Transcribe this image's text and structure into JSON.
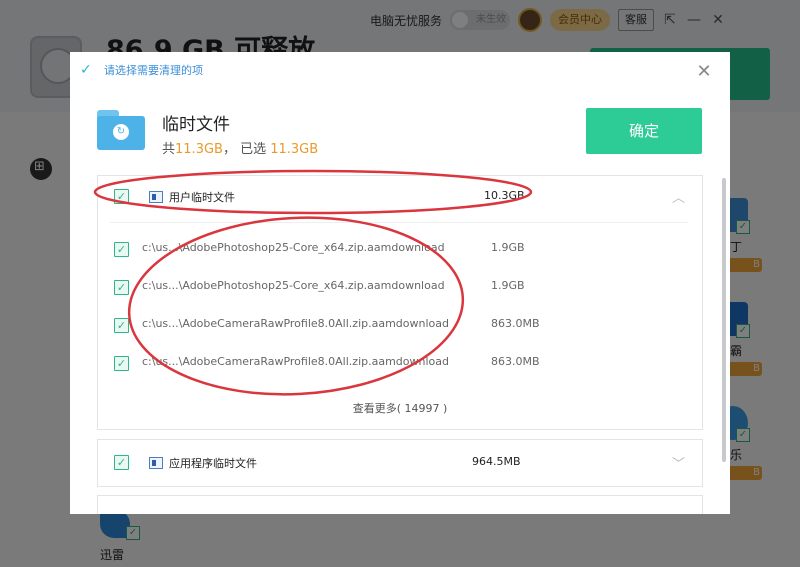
{
  "background_app": {
    "headline": "86.9 GB 可释放",
    "topbar": {
      "service_label": "电脑无忧服务",
      "toggle_label": "未生效",
      "vip_label": "会员中心",
      "support_label": "客服"
    },
    "side_apps": [
      {
        "label": "丁",
        "badge": "B"
      },
      {
        "label": "霸",
        "badge": "B"
      },
      {
        "label": "乐",
        "badge": "B"
      }
    ],
    "bottom_app": {
      "label": "迅雷"
    }
  },
  "dialog": {
    "title": "请选择需要清理的项",
    "category": {
      "name": "临时文件",
      "summary_total_prefix": "共",
      "summary_total": "11.3GB",
      "summary_sep": "，  已选",
      "summary_selected": "11.3GB"
    },
    "confirm_label": "确定",
    "sections": [
      {
        "name": "用户临时文件",
        "size": "10.3GB",
        "expanded": true,
        "files": [
          {
            "path": "c:\\us...\\AdobePhotoshop25-Core_x64.zip.aamdownload",
            "size": "1.9GB"
          },
          {
            "path": "c:\\us...\\AdobePhotoshop25-Core_x64.zip.aamdownload",
            "size": "1.9GB"
          },
          {
            "path": "c:\\us...\\AdobeCameraRawProfile8.0All.zip.aamdownload",
            "size": "863.0MB"
          },
          {
            "path": "c:\\us...\\AdobeCameraRawProfile8.0All.zip.aamdownload",
            "size": "863.0MB"
          }
        ],
        "more_label": "查看更多( 14997 )"
      },
      {
        "name": "应用程序临时文件",
        "size": "964.5MB",
        "expanded": false
      }
    ]
  },
  "colors": {
    "accent_green": "#2dcb96",
    "highlight_orange": "#e99a2a",
    "annotation_red": "#d9363e"
  }
}
